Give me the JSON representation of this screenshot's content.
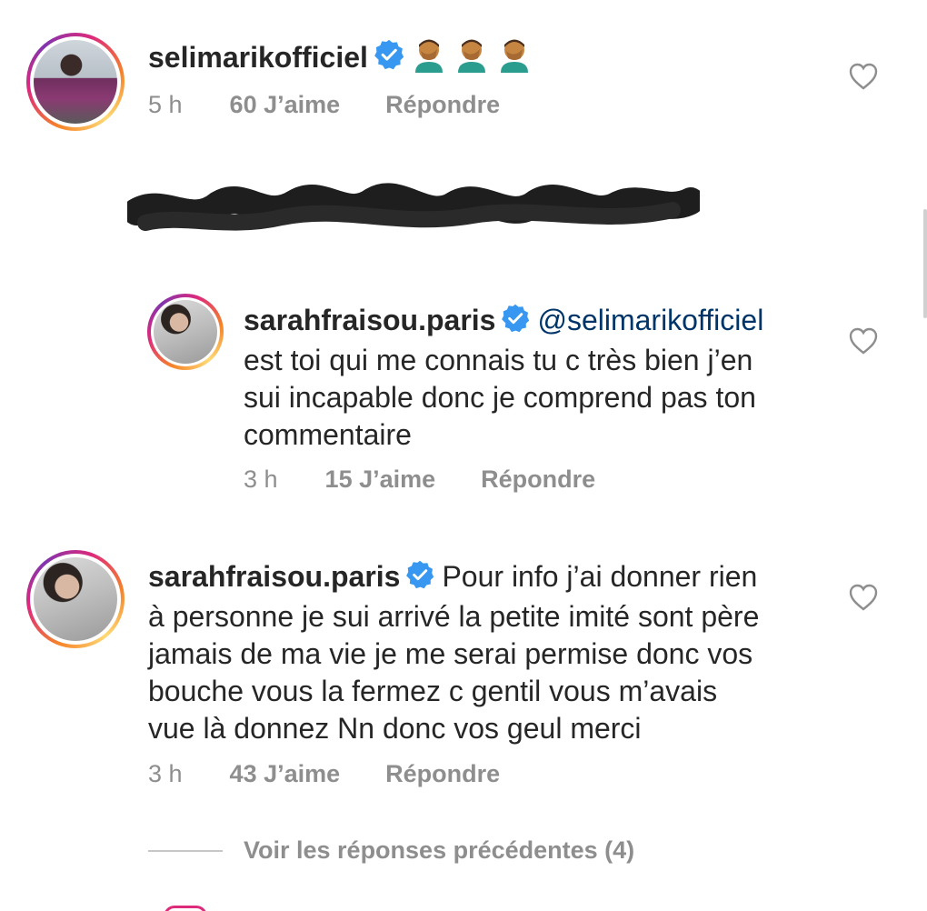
{
  "comments": [
    {
      "username": "selimarikofficiel",
      "verified": true,
      "emoji": [
        "facepalm-emoji",
        "facepalm-emoji",
        "facepalm-emoji"
      ],
      "time": "5 h",
      "likes": "60 J’aime",
      "reply": "Répondre"
    },
    {
      "username": "sarahfraisou.paris",
      "verified": true,
      "mention": "@selimarikofficiel",
      "lines": [
        "est toi qui me connais tu c très bien j’en",
        "sui incapable donc je comprend pas ton",
        "commentaire"
      ],
      "time": "3 h",
      "likes": "15 J’aime",
      "reply": "Répondre"
    },
    {
      "username": "sarahfraisou.paris",
      "verified": true,
      "first_line_text": "Pour info j’ai donner rien",
      "lines": [
        "à personne je sui arrivé la petite imité sont père",
        "jamais de ma vie je me serai permise donc vos",
        "bouche vous la fermez c gentil vous m’avais",
        "vue là donnez Nn donc vos geul merci"
      ],
      "time": "3 h",
      "likes": "43 J’aime",
      "reply": "Répondre"
    }
  ],
  "view_previous_replies": "Voir les réponses précédentes (4)",
  "colors": {
    "verified": "#3897f0",
    "meta_gray": "#8e8e8e",
    "mention": "#003569",
    "text": "#262626"
  },
  "icons": [
    "verified-badge-icon",
    "heart-outline-icon",
    "facepalm-emoji"
  ]
}
